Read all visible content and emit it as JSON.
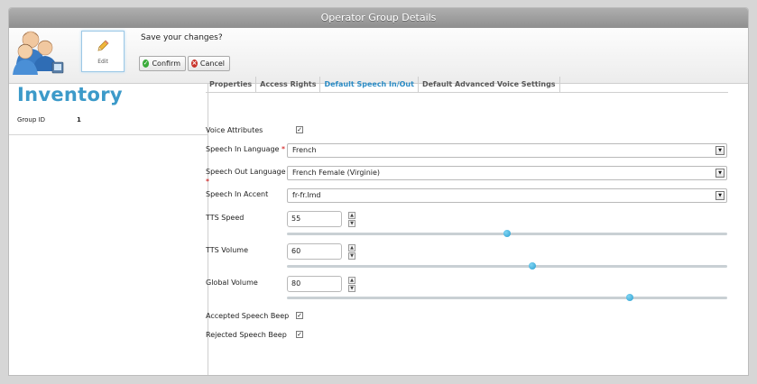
{
  "window": {
    "title": "Operator Group Details"
  },
  "toolbar": {
    "edit_label": "Edit",
    "prompt": "Save your changes?",
    "confirm_label": "Confirm",
    "cancel_label": "Cancel"
  },
  "left": {
    "title": "Inventory",
    "group_id_label": "Group ID",
    "group_id_value": "1"
  },
  "tabs": [
    {
      "label": "Properties",
      "active": false
    },
    {
      "label": "Access Rights",
      "active": false
    },
    {
      "label": "Default Speech In/Out",
      "active": true
    },
    {
      "label": "Default Advanced Voice Settings",
      "active": false
    }
  ],
  "form": {
    "voice_attributes": {
      "label": "Voice Attributes",
      "checked": true
    },
    "speech_in_language": {
      "label": "Speech In Language",
      "required_mark": "*",
      "value": "French"
    },
    "speech_out_language": {
      "label": "Speech Out Language",
      "required_mark": "*",
      "value": "French Female (Virginie)"
    },
    "speech_in_accent": {
      "label": "Speech In Accent",
      "value": "fr-fr.lmd"
    },
    "tts_speed": {
      "label": "TTS Speed",
      "value": "55",
      "slider_fraction": 0.5
    },
    "tts_volume": {
      "label": "TTS Volume",
      "value": "60",
      "slider_fraction": 0.557
    },
    "global_volume": {
      "label": "Global Volume",
      "value": "80",
      "slider_fraction": 0.778
    },
    "accepted_speech_beep": {
      "label": "Accepted Speech Beep",
      "checked": true
    },
    "rejected_speech_beep": {
      "label": "Rejected Speech Beep",
      "checked": true
    }
  },
  "icons": {
    "users": "users-group-icon",
    "edit": "pencil-icon",
    "confirm": "check-circle-icon",
    "cancel": "x-circle-icon",
    "dropdown": "dropdown-arrow-icon",
    "spin_up": "spin-up-icon",
    "spin_down": "spin-down-icon",
    "checkmark": "check-icon"
  },
  "colors": {
    "accent": "#3c9ac9",
    "active_tab": "#2b8bc4",
    "slider_knob": "#2a9fd0",
    "confirm_icon": "#3aab3a",
    "cancel_icon": "#c9342b"
  }
}
